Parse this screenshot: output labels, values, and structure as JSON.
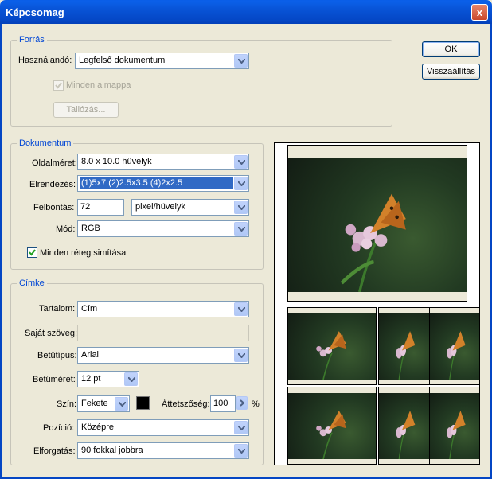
{
  "window": {
    "title": "Képcsomag",
    "close_glyph": "x"
  },
  "buttons": {
    "ok": "OK",
    "reset": "Visszaállítás"
  },
  "source": {
    "legend": "Forrás",
    "use_label": "Használandó:",
    "use_value": "Legfelső dokumentum",
    "include_subfolders_label": "Minden almappa",
    "include_subfolders_checked": true,
    "browse_label": "Tallózás..."
  },
  "document": {
    "legend": "Dokumentum",
    "page_size_label": "Oldalméret:",
    "page_size_value": "8.0 x 10.0 hüvelyk",
    "layout_label": "Elrendezés:",
    "layout_value": "(1)5x7 (2)2.5x3.5 (4)2x2.5",
    "resolution_label": "Felbontás:",
    "resolution_value": "72",
    "resolution_unit": "pixel/hüvelyk",
    "mode_label": "Mód:",
    "mode_value": "RGB",
    "flatten_label": "Minden réteg simítása",
    "flatten_checked": true
  },
  "label_section": {
    "legend": "Címke",
    "content_label": "Tartalom:",
    "content_value": "Cím",
    "custom_text_label": "Saját szöveg:",
    "custom_text_value": "",
    "font_label": "Betűtípus:",
    "font_value": "Arial",
    "font_size_label": "Betűméret:",
    "font_size_value": "12 pt",
    "color_label": "Szín:",
    "color_value": "Fekete",
    "color_swatch": "#000000",
    "opacity_label": "Áttetszőség:",
    "opacity_value": "100",
    "opacity_unit": "%",
    "position_label": "Pozíció:",
    "position_value": "Középre",
    "rotate_label": "Elforgatás:",
    "rotate_value": "90 fokkal jobbra"
  },
  "colors": {
    "accent": "#0046d5",
    "title_bar": "#0446c4",
    "dialog_bg": "#ece9d8",
    "selection": "#316ac5"
  }
}
